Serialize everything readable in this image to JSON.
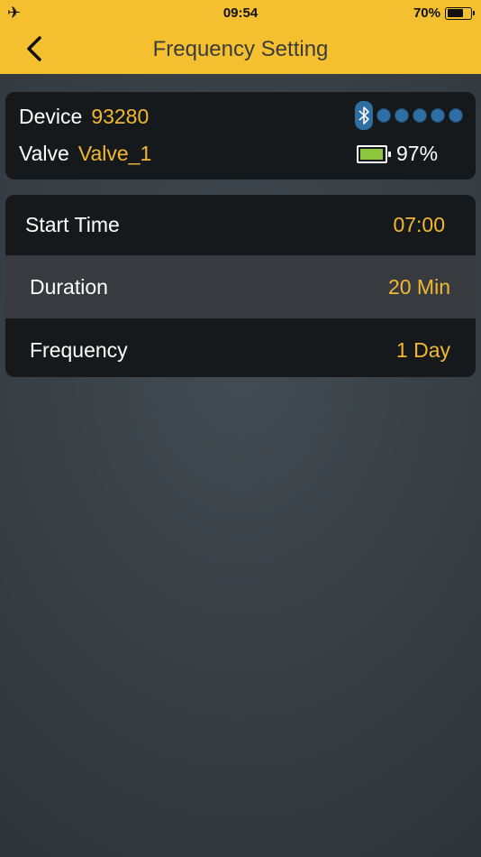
{
  "status_bar": {
    "time": "09:54",
    "battery_percent": "70%",
    "battery_level": 0.7
  },
  "nav": {
    "title": "Frequency Setting"
  },
  "device": {
    "device_label": "Device",
    "device_id": "93280",
    "valve_label": "Valve",
    "valve_name": "Valve_1",
    "signal_dots": 5,
    "battery_percent": "97%",
    "battery_level": 0.97
  },
  "settings": {
    "start_time": {
      "label": "Start Time",
      "value": "07:00"
    },
    "duration": {
      "label": "Duration",
      "value": "20 Min"
    },
    "frequency": {
      "label": "Frequency",
      "value": "1 Day"
    }
  },
  "colors": {
    "accent": "#f4c030",
    "value_text": "#f2b733",
    "card_bg": "#16191c",
    "battery_green": "#8cc63e",
    "bluetooth_blue": "#2f6fa0"
  }
}
